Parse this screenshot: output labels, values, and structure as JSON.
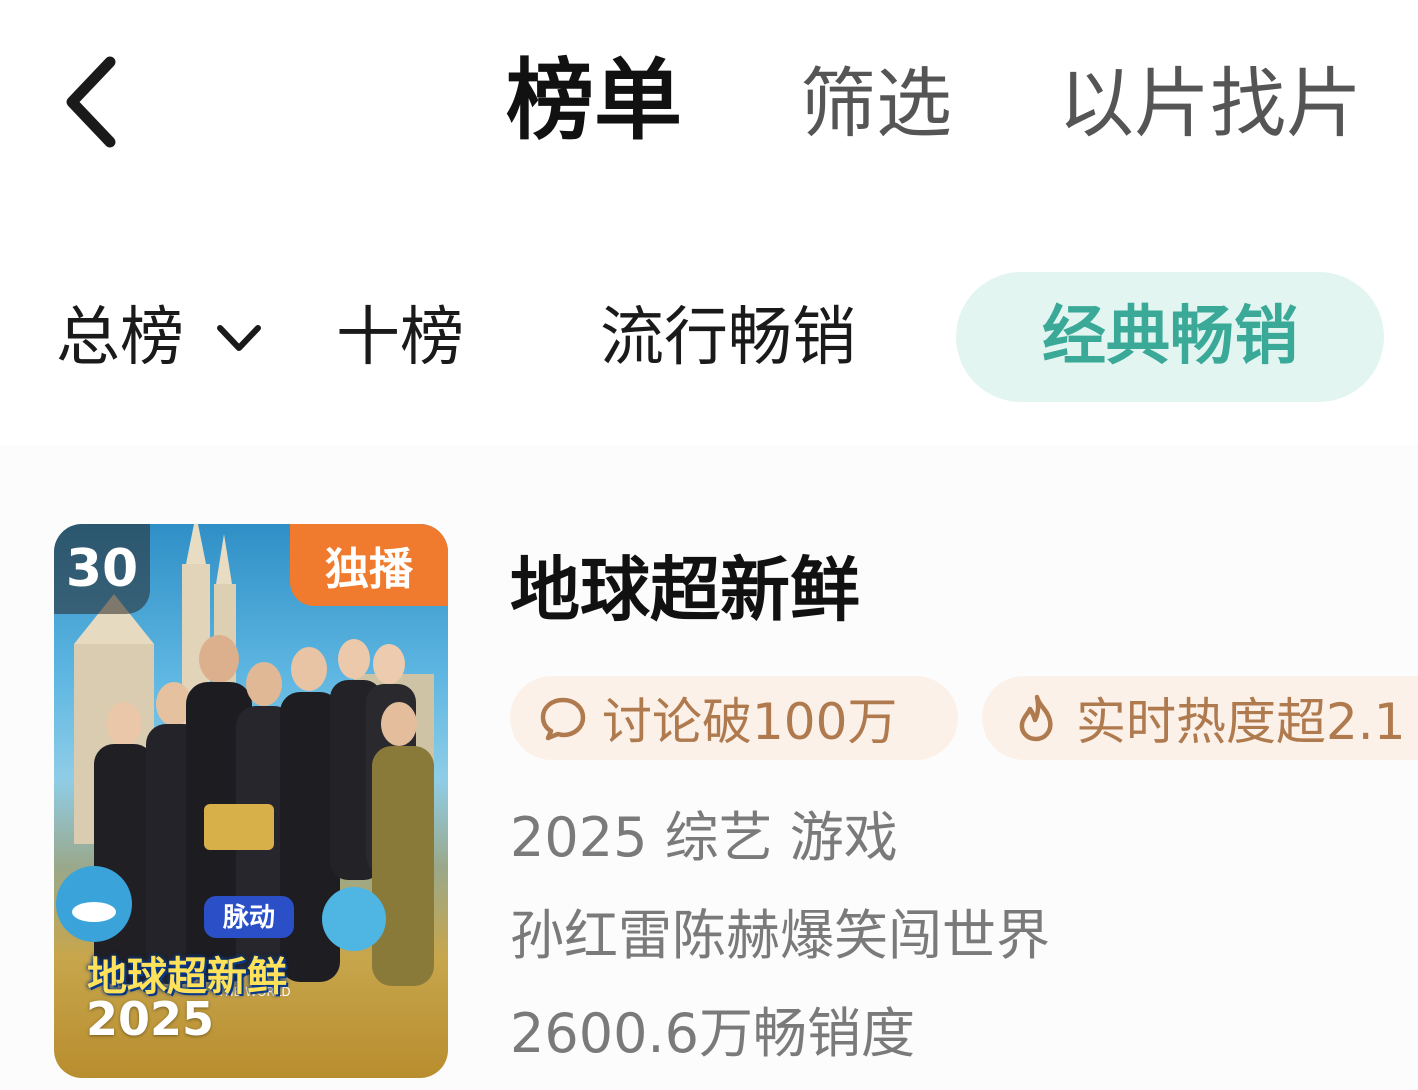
{
  "header": {
    "title": "榜单",
    "filter_label": "筛选",
    "search_by_image_label": "以片找片"
  },
  "tabs": [
    {
      "label": "总榜",
      "has_dropdown": true,
      "active": false
    },
    {
      "label": "十榜",
      "active": false
    },
    {
      "label": "流行畅销",
      "active": false
    },
    {
      "label": "经典畅销",
      "active": true
    }
  ],
  "colors": {
    "active_tab_bg": "#e3f5f1",
    "active_tab_text": "#3aa998",
    "tag_bg": "#fbf1e9",
    "tag_text": "#b07a4f",
    "exclusive_badge": "#f07a2d"
  },
  "item": {
    "rank": "30",
    "badge": "独播",
    "poster_show_name": "地球超新鲜",
    "poster_year": "2025",
    "title": "地球超新鲜",
    "tags": [
      {
        "icon": "comment-icon",
        "text": "讨论破100万"
      },
      {
        "icon": "flame-icon",
        "text": "实时热度超2.1"
      }
    ],
    "year_genre": "2025 综艺 游戏",
    "description": "孙红雷陈赫爆笑闯世界",
    "sales": "2600.6万畅销度"
  }
}
